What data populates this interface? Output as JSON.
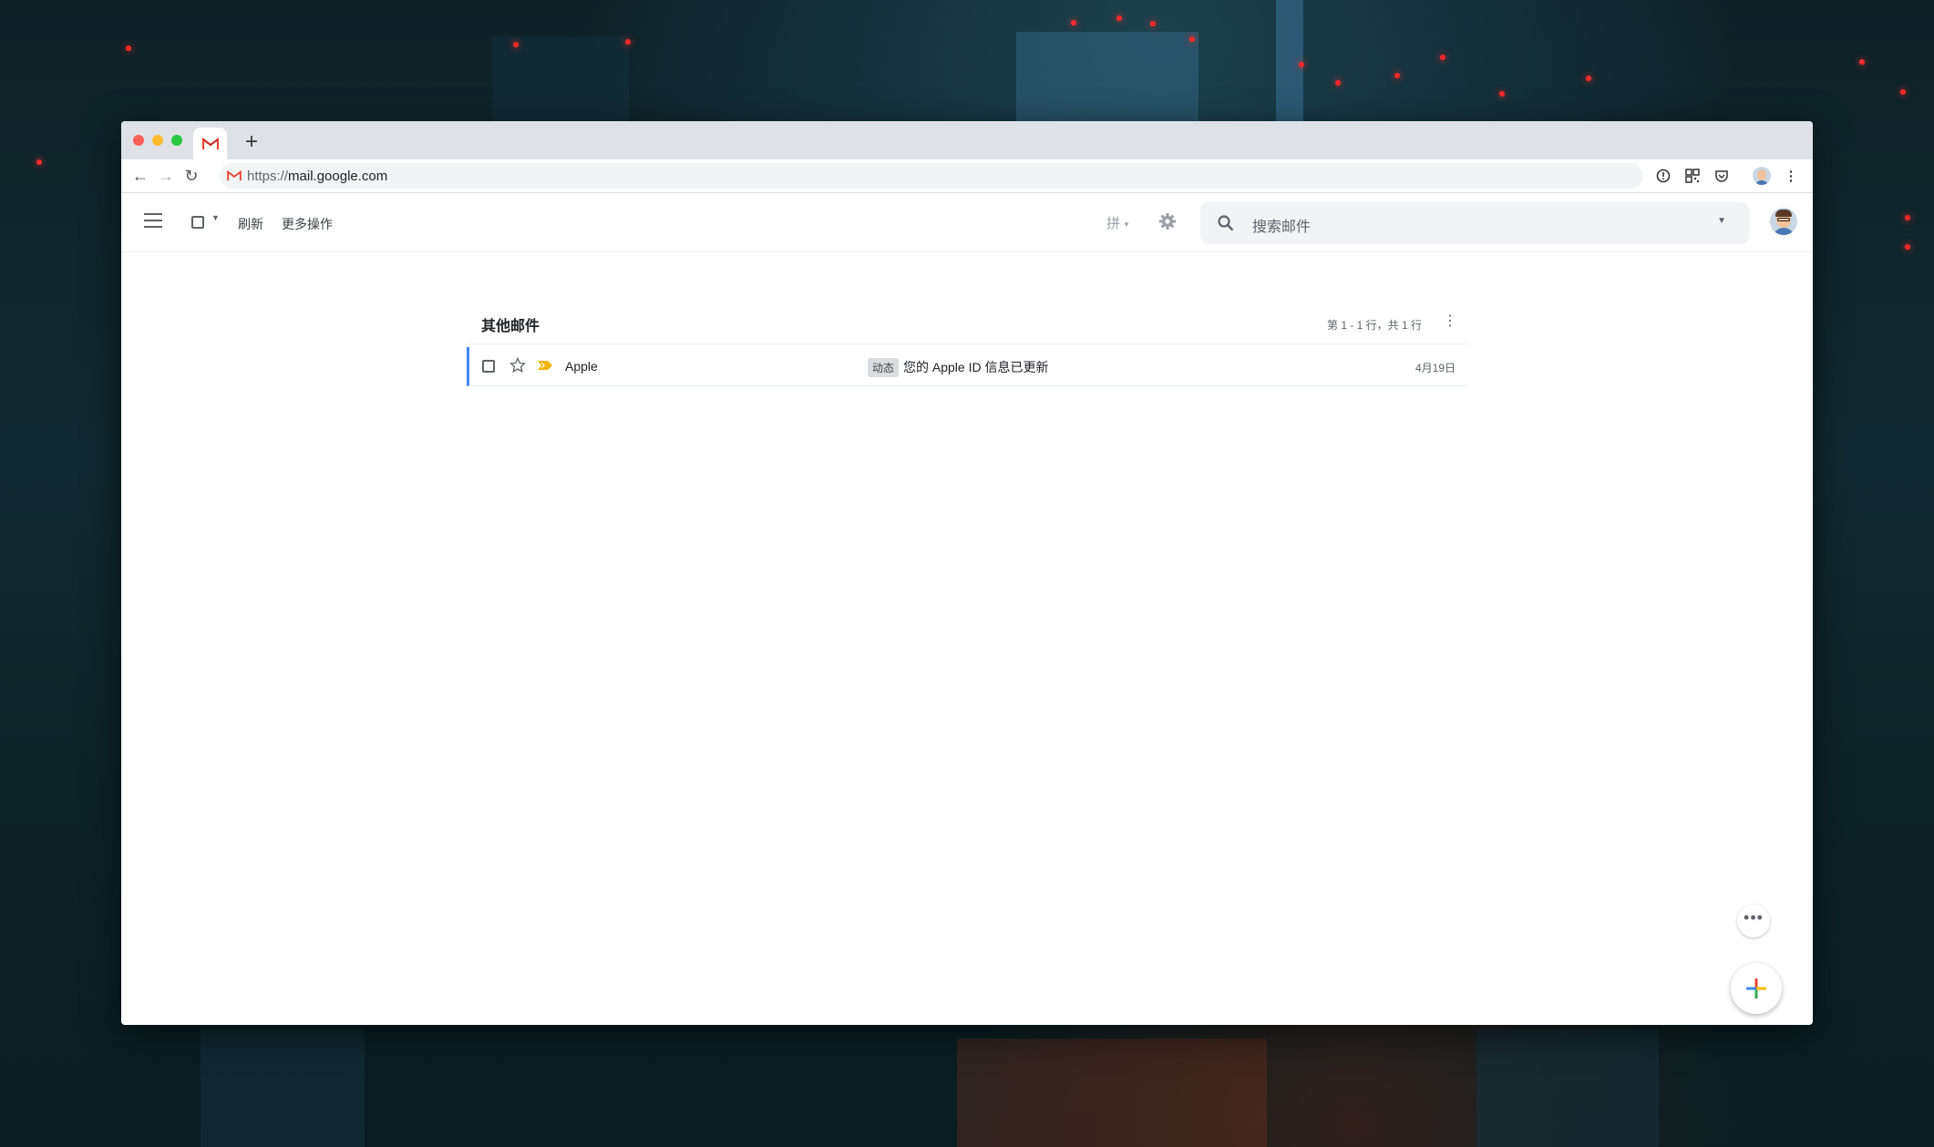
{
  "browser": {
    "url_scheme": "https://",
    "url_host": "mail.google.com",
    "new_tab_label": "+"
  },
  "toolbar": {
    "refresh_label": "刷新",
    "more_actions_label": "更多操作",
    "input_method_label": "拼"
  },
  "search": {
    "placeholder": "搜索邮件"
  },
  "inbox": {
    "section_title": "其他邮件",
    "pagination": "第 1 - 1 行，共 1 行",
    "emails": [
      {
        "sender": "Apple",
        "label": "动态",
        "subject": "您的 Apple ID 信息已更新",
        "date": "4月19日"
      }
    ]
  },
  "colors": {
    "accent": "#4285f4",
    "gmail_red": "#ea4335",
    "importance_marker": "#f4b400"
  },
  "icons": [
    "gmail-icon",
    "back-icon",
    "forward-icon",
    "reload-icon",
    "info-icon",
    "qr-icon",
    "pocket-icon",
    "profile-icon",
    "menu-dots-icon",
    "hamburger-icon",
    "checkbox-icon",
    "dropdown-icon",
    "gear-icon",
    "search-icon",
    "star-icon",
    "importance-icon",
    "compose-plus-icon"
  ]
}
